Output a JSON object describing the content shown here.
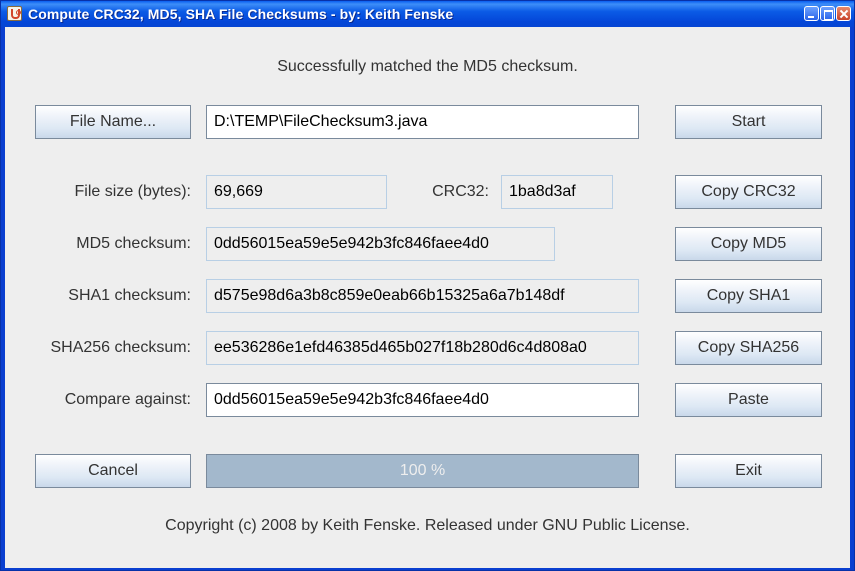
{
  "window": {
    "title": "Compute CRC32, MD5, SHA File Checksums - by: Keith Fenske"
  },
  "status_message": "Successfully matched the MD5 checksum.",
  "file": {
    "button_label": "File Name...",
    "button_mnemonic": "F",
    "path": "D:\\TEMP\\FileChecksum3.java"
  },
  "buttons": {
    "start": "Start",
    "copy_crc32": "Copy CRC32",
    "copy_md5": "Copy MD5",
    "copy_sha1": "Copy SHA1",
    "copy_sha256": "Copy SHA256",
    "paste": "Paste",
    "cancel": "Cancel",
    "exit": "Exit"
  },
  "labels": {
    "file_size": "File size (bytes):",
    "crc32": "CRC32:",
    "md5": "MD5 checksum:",
    "sha1": "SHA1 checksum:",
    "sha256": "SHA256 checksum:",
    "compare": "Compare against:"
  },
  "values": {
    "file_size": "69,669",
    "crc32": "1ba8d3af",
    "md5": "0dd56015ea59e5e942b3fc846faee4d0",
    "sha1": "d575e98d6a3b8c859e0eab66b15325a6a7b148df",
    "sha256": "ee536286e1efd46385d465b027f18b280d6c4d808a0",
    "compare": "0dd56015ea59e5e942b3fc846faee4d0"
  },
  "progress": {
    "percent": 100,
    "text": "100 %"
  },
  "copyright": "Copyright (c) 2008 by Keith Fenske.  Released under GNU Public License."
}
